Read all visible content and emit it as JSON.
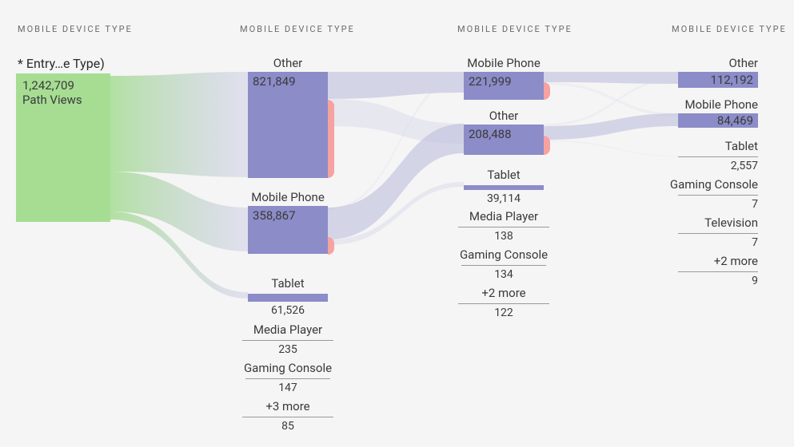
{
  "headers": {
    "col1": "MOBILE DEVICE TYPE",
    "col2": "MOBILE DEVICE TYPE",
    "col3": "MOBILE DEVICE TYPE",
    "col4": "MOBILE DEVICE TYPE"
  },
  "entry": {
    "title": "* Entry…e Type)",
    "value": "1,242,709",
    "sublabel": "Path Views"
  },
  "col2": {
    "n1": {
      "label": "Other",
      "value": "821,849"
    },
    "n2": {
      "label": "Mobile Phone",
      "value": "358,867"
    },
    "n3": {
      "label": "Tablet",
      "value": "61,526"
    },
    "n4": {
      "label": "Media Player",
      "value": "235"
    },
    "n5": {
      "label": "Gaming Console",
      "value": "147"
    },
    "n6": {
      "label": "+3 more",
      "value": "85"
    }
  },
  "col3": {
    "n1": {
      "label": "Mobile Phone",
      "value": "221,999"
    },
    "n2": {
      "label": "Other",
      "value": "208,488"
    },
    "n3": {
      "label": "Tablet",
      "value": "39,114"
    },
    "n4": {
      "label": "Media Player",
      "value": "138"
    },
    "n5": {
      "label": "Gaming Console",
      "value": "134"
    },
    "n6": {
      "label": "+2 more",
      "value": "122"
    }
  },
  "col4": {
    "n1": {
      "label": "Other",
      "value": "112,192"
    },
    "n2": {
      "label": "Mobile Phone",
      "value": "84,469"
    },
    "n3": {
      "label": "Tablet",
      "value": "2,557"
    },
    "n4": {
      "label": "Gaming Console",
      "value": "7"
    },
    "n5": {
      "label": "Television",
      "value": "7"
    },
    "n6": {
      "label": "+2 more",
      "value": "9"
    }
  },
  "chart_data": {
    "type": "sankey",
    "title": "",
    "dimension": "Mobile Device Type",
    "columns": [
      "Entry (Mobile Device Type)",
      "Mobile Device Type",
      "Mobile Device Type",
      "Mobile Device Type"
    ],
    "nodes": [
      {
        "id": "entry",
        "col": 0,
        "label": "* Entry (Mobile Device Type)",
        "value": 1242709,
        "meta": "Path Views"
      },
      {
        "id": "c2_other",
        "col": 1,
        "label": "Other",
        "value": 821849
      },
      {
        "id": "c2_mobile",
        "col": 1,
        "label": "Mobile Phone",
        "value": 358867
      },
      {
        "id": "c2_tablet",
        "col": 1,
        "label": "Tablet",
        "value": 61526
      },
      {
        "id": "c2_media",
        "col": 1,
        "label": "Media Player",
        "value": 235
      },
      {
        "id": "c2_gaming",
        "col": 1,
        "label": "Gaming Console",
        "value": 147
      },
      {
        "id": "c2_more",
        "col": 1,
        "label": "+3 more",
        "value": 85
      },
      {
        "id": "c3_mobile",
        "col": 2,
        "label": "Mobile Phone",
        "value": 221999
      },
      {
        "id": "c3_other",
        "col": 2,
        "label": "Other",
        "value": 208488
      },
      {
        "id": "c3_tablet",
        "col": 2,
        "label": "Tablet",
        "value": 39114
      },
      {
        "id": "c3_media",
        "col": 2,
        "label": "Media Player",
        "value": 138
      },
      {
        "id": "c3_gaming",
        "col": 2,
        "label": "Gaming Console",
        "value": 134
      },
      {
        "id": "c3_more",
        "col": 2,
        "label": "+2 more",
        "value": 122
      },
      {
        "id": "c4_other",
        "col": 3,
        "label": "Other",
        "value": 112192
      },
      {
        "id": "c4_mobile",
        "col": 3,
        "label": "Mobile Phone",
        "value": 84469
      },
      {
        "id": "c4_tablet",
        "col": 3,
        "label": "Tablet",
        "value": 2557
      },
      {
        "id": "c4_gaming",
        "col": 3,
        "label": "Gaming Console",
        "value": 7
      },
      {
        "id": "c4_tv",
        "col": 3,
        "label": "Television",
        "value": 7
      },
      {
        "id": "c4_more",
        "col": 3,
        "label": "+2 more",
        "value": 9
      }
    ]
  }
}
